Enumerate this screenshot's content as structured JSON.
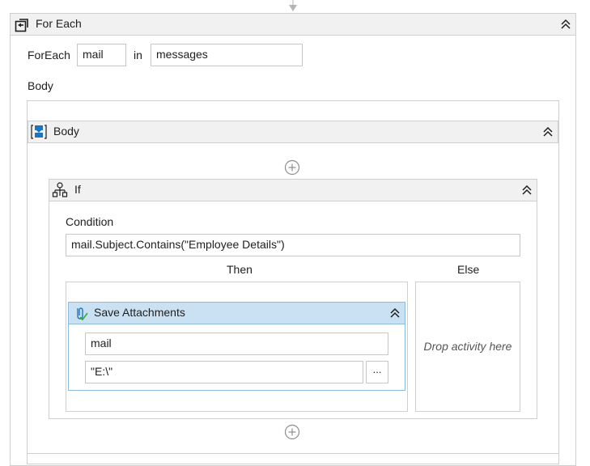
{
  "foreach": {
    "title": "For Each",
    "foreach_label": "ForEach",
    "item_value": "mail",
    "in_label": "in",
    "collection_value": "messages",
    "body_label": "Body"
  },
  "sequence": {
    "title": "Body"
  },
  "if_activity": {
    "title": "If",
    "condition_label": "Condition",
    "condition_value": "mail.Subject.Contains(\"Employee Details\")",
    "then_label": "Then",
    "else_label": "Else",
    "else_placeholder": "Drop activity here"
  },
  "save_attachments": {
    "title": "Save Attachments",
    "message_value": "mail",
    "folder_value": "\"E:\\\"",
    "browse_label": "..."
  },
  "icons": {
    "foreach": "foreach-loop-icon",
    "sequence": "sequence-icon",
    "if": "if-flowchart-icon",
    "attachment": "paperclip-icon",
    "collapse": "double-chevron-up-icon",
    "add": "plus-circle-icon"
  },
  "colors": {
    "header_gray": "#f1f1f1",
    "header_blue": "#c9e1f2",
    "border": "#cfcfcf",
    "icon_blue": "#1e73be"
  }
}
